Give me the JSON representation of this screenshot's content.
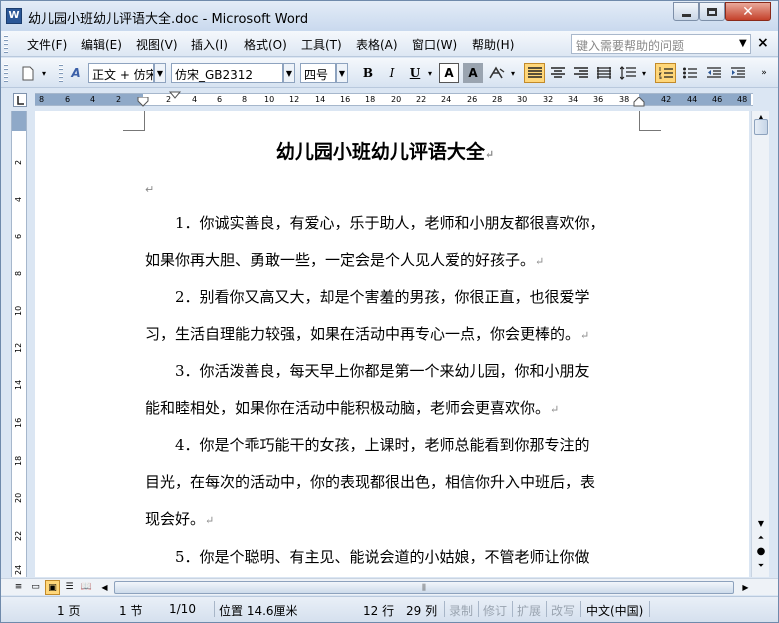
{
  "window": {
    "title": "幼儿园小班幼儿评语大全.doc - Microsoft Word",
    "app_icon_letter": "W"
  },
  "menu": {
    "items": [
      "文件(F)",
      "编辑(E)",
      "视图(V)",
      "插入(I)",
      "格式(O)",
      "工具(T)",
      "表格(A)",
      "窗口(W)",
      "帮助(H)"
    ],
    "help_placeholder": "键入需要帮助的问题"
  },
  "toolbar": {
    "style_value": "正文 + 仿宋",
    "font_value": "仿宋_GB2312",
    "size_value": "四号",
    "bold": "B",
    "italic": "I",
    "underline": "U",
    "font_color_letter": "A",
    "shading_letter": "A"
  },
  "ruler": {
    "h_labels": [
      "8",
      "6",
      "4",
      "2",
      "2",
      "4",
      "6",
      "8",
      "10",
      "12",
      "14",
      "16",
      "18",
      "20",
      "22",
      "24",
      "26",
      "28",
      "30",
      "32",
      "34",
      "36",
      "38",
      "42",
      "44",
      "46",
      "48"
    ],
    "v_labels": [
      "2",
      "4",
      "6",
      "8",
      "10",
      "12",
      "14",
      "16",
      "18",
      "20",
      "22",
      "24"
    ]
  },
  "document": {
    "title": "幼儿园小班幼儿评语大全",
    "paragraphs": [
      {
        "lines": [
          "1．你诚实善良，有爱心，乐于助人，老师和小朋友都很喜欢你，",
          "如果你再大胆、勇敢一些，一定会是个人见人爱的好孩子。"
        ]
      },
      {
        "lines": [
          "2．别看你又高又大，却是个害羞的男孩，你很正直，也很爱学",
          "习，生活自理能力较强，如果在活动中再专心一点，你会更棒的。"
        ]
      },
      {
        "lines": [
          "3．你活泼善良，每天早上你都是第一个来幼儿园，你和小朋友",
          "能和睦相处，如果你在活动中能积极动脑，老师会更喜欢你。"
        ]
      },
      {
        "lines": [
          "4．你是个乖巧能干的女孩，上课时，老师总能看到你那专注的",
          "目光，在每次的活动中，你的表现都很出色，相信你升入中班后，表",
          "现会好。"
        ]
      },
      {
        "lines": [
          "5．你是个聪明、有主见、能说会道的小姑娘，不管老师让你做"
        ]
      }
    ]
  },
  "status": {
    "page": "1 页",
    "section": "1 节",
    "page_of": "1/10",
    "position": "位置 14.6厘米",
    "line": "12 行",
    "column": "29 列",
    "rec": "录制",
    "trk": "修订",
    "ext": "扩展",
    "ovr": "改写",
    "language": "中文(中国)"
  }
}
